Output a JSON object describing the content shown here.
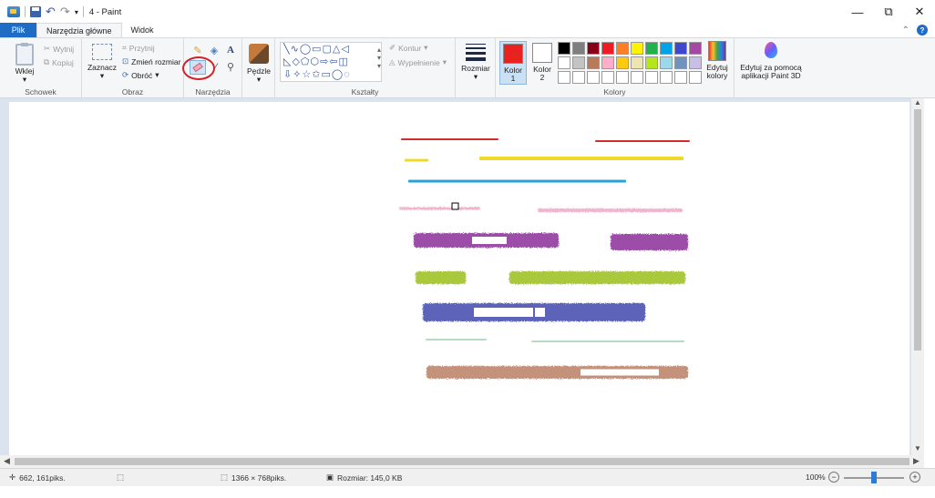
{
  "window": {
    "title": "4 - Paint",
    "controls": {
      "minimize": "—",
      "maximize": "⧉",
      "close": "✕"
    }
  },
  "quick_access": {
    "icons": [
      "paint-app-icon",
      "save-icon",
      "undo-icon",
      "redo-icon",
      "customize-dropdown-icon"
    ]
  },
  "tabs": [
    {
      "label": "Plik"
    },
    {
      "label": "Narzędzia główne"
    },
    {
      "label": "Widok"
    }
  ],
  "ribbon": {
    "clipboard": {
      "paste": "Wklej",
      "cut": "Wytnij",
      "copy": "Kopiuj",
      "group_label": "Schowek"
    },
    "image": {
      "select": "Zaznacz",
      "crop": "Przytnij",
      "resize": "Zmień rozmiar",
      "rotate": "Obróć",
      "group_label": "Obraz"
    },
    "tools": {
      "group_label": "Narzędzia",
      "items": [
        "pencil-icon",
        "fill-icon",
        "text-icon",
        "eraser-icon",
        "color-picker-icon",
        "magnifier-icon"
      ],
      "selected": "eraser-icon",
      "highlight_color": "#d22027"
    },
    "brushes": {
      "label": "Pędzle"
    },
    "shapes": {
      "outline": "Kontur",
      "fill": "Wypełnienie",
      "group_label": "Kształty"
    },
    "size": {
      "label": "Rozmiar"
    },
    "colors": {
      "color1": {
        "label": "Kolor",
        "number": "1",
        "value": "#e8231f"
      },
      "color2": {
        "label": "Kolor",
        "number": "2",
        "value": "#ffffff"
      },
      "palette": [
        "#000000",
        "#7f7f7f",
        "#880015",
        "#ed1c24",
        "#ff7f27",
        "#fff200",
        "#22b14c",
        "#00a2e8",
        "#3f48cc",
        "#a349a4",
        "#ffffff",
        "#c3c3c3",
        "#b97a57",
        "#ffaec9",
        "#ffc90e",
        "#efe4b0",
        "#b5e61d",
        "#99d9ea",
        "#7092be",
        "#c8bfe7",
        "#ffffff",
        "#ffffff",
        "#ffffff",
        "#ffffff",
        "#ffffff",
        "#ffffff",
        "#ffffff",
        "#ffffff",
        "#ffffff",
        "#ffffff"
      ],
      "edit_colors": "Edytuj kolory",
      "group_label": "Kolory"
    },
    "paint3d": {
      "label_line1": "Edytuj za pomocą",
      "label_line2": "aplikacji Paint 3D"
    }
  },
  "canvas": {
    "strokes": [
      {
        "color": "#d52b2b",
        "kind": "line"
      },
      {
        "color": "#d52b2b",
        "kind": "line"
      },
      {
        "color": "#f0d82a",
        "kind": "line"
      },
      {
        "color": "#f0d82a",
        "kind": "line"
      },
      {
        "color": "#2a9fd8",
        "kind": "line"
      },
      {
        "color": "#f0a8c4",
        "kind": "dotted"
      },
      {
        "color": "#f0a8c4",
        "kind": "dotted"
      },
      {
        "color": "#9c4da8",
        "kind": "brush"
      },
      {
        "color": "#9c4da8",
        "kind": "brush"
      },
      {
        "color": "#a9c83a",
        "kind": "brush"
      },
      {
        "color": "#a9c83a",
        "kind": "brush"
      },
      {
        "color": "#5b63b8",
        "kind": "brush"
      },
      {
        "color": "#b5dcc0",
        "kind": "line"
      },
      {
        "color": "#b5dcc0",
        "kind": "line"
      },
      {
        "color": "#c4917a",
        "kind": "brush"
      }
    ]
  },
  "status": {
    "cursor_pos": "662, 161piks.",
    "dimensions": "1366 × 768piks.",
    "size": "Rozmiar: 145,0 KB",
    "zoom": "100%",
    "zoom_minus": "−",
    "zoom_plus": "+"
  }
}
